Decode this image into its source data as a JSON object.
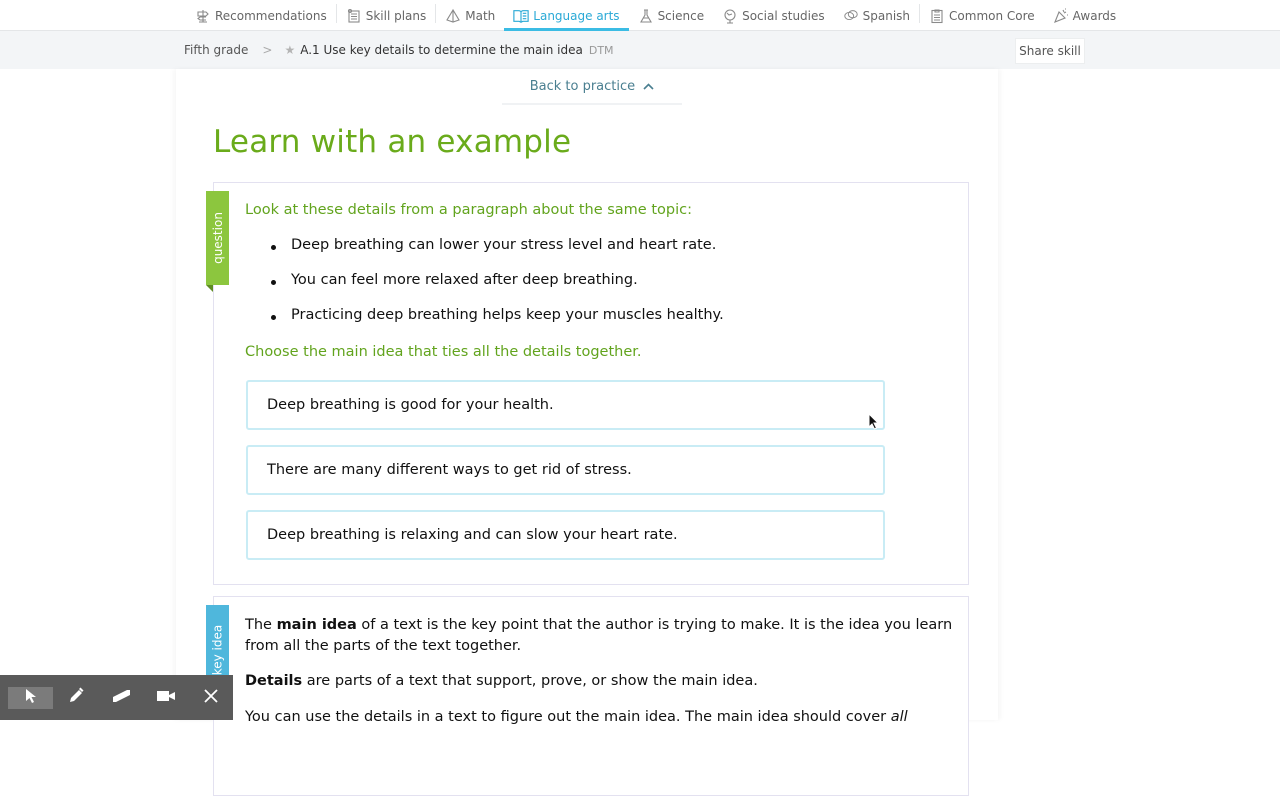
{
  "nav": {
    "items": [
      {
        "label": "Recommendations",
        "icon": "signpost-icon",
        "active": false
      },
      {
        "label": "Skill plans",
        "icon": "checklist-icon",
        "active": false
      },
      {
        "label": "Math",
        "icon": "pyramid-icon",
        "active": false
      },
      {
        "label": "Language arts",
        "icon": "book-icon",
        "active": true
      },
      {
        "label": "Science",
        "icon": "flask-icon",
        "active": false
      },
      {
        "label": "Social studies",
        "icon": "globe-icon",
        "active": false
      },
      {
        "label": "Spanish",
        "icon": "speech-bubbles-icon",
        "active": false
      },
      {
        "label": "Common Core",
        "icon": "clipboard-icon",
        "active": false
      },
      {
        "label": "Awards",
        "icon": "party-horn-icon",
        "active": false
      }
    ],
    "accent_color": "#3bbce4"
  },
  "breadcrumb": {
    "grade": "Fifth grade",
    "separator": ">",
    "skill": "A.1 Use key details to determine the main idea",
    "code": "DTM"
  },
  "share_button": "Share skill",
  "back_link": "Back to practice",
  "page_title": "Learn with an example",
  "question": {
    "ribbon_label": "question",
    "intro": "Look at these details from a paragraph about the same topic:",
    "details": [
      "Deep breathing can lower your stress level and heart rate.",
      "You can feel more relaxed after deep breathing.",
      "Practicing deep breathing helps keep your muscles healthy."
    ],
    "prompt": "Choose the main idea that ties all the details together.",
    "choices": [
      "Deep breathing is good for your health.",
      "There are many different ways to get rid of stress.",
      "Deep breathing is relaxing and can slow your heart rate."
    ]
  },
  "key_idea": {
    "ribbon_label": "key idea",
    "p1_pre": "The ",
    "p1_bold": "main idea",
    "p1_post": " of a text is the key point that the author is trying to make. It is the idea you learn from all the parts of the text together.",
    "p2_bold": "Details",
    "p2_post": " are parts of a text that support, prove, or show the main idea.",
    "p3_pre": "You can use the details in a text to figure out the main idea. The main idea should cover ",
    "p3_italic": "all"
  },
  "toolbar": {
    "tools": [
      "pointer-tool",
      "pen-tool",
      "highlighter-tool",
      "camera-tool",
      "close-tool"
    ]
  },
  "colors": {
    "title_green": "#6aab1b",
    "question_ribbon": "#8cc63e",
    "key_idea_ribbon": "#4fb7dc",
    "choice_border": "#c9ecf5"
  }
}
